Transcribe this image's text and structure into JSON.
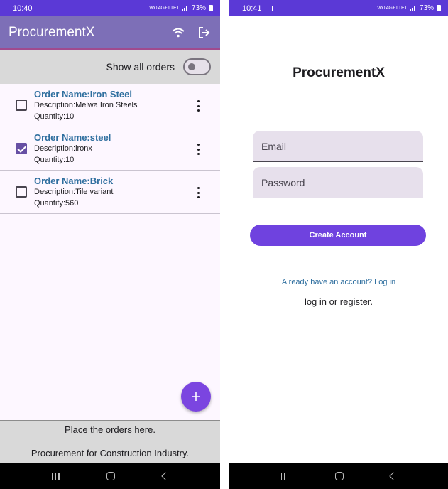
{
  "left_screen": {
    "status": {
      "time": "10:40",
      "network": "Vo0 4G+ LTE1",
      "battery": "73%"
    },
    "appbar": {
      "title": "ProcurementX",
      "wifi_icon": "wifi-icon",
      "logout_icon": "logout-icon"
    },
    "toggle": {
      "label": "Show all orders",
      "state": "off"
    },
    "orders": [
      {
        "name": "Order Name:Iron Steel",
        "description": "Description:Melwa Iron Steels",
        "quantity": "Quantity:10",
        "checked": false
      },
      {
        "name": "Order Name:steel",
        "description": "Description:ironx",
        "quantity": "Quantity:10",
        "checked": true
      },
      {
        "name": "Order Name:Brick",
        "description": "Description:Tile variant",
        "quantity": "Quantity:560",
        "checked": false
      }
    ],
    "fab_label": "+",
    "footer": {
      "line1": "Place the orders here.",
      "line2": "Procurement for Construction Industry."
    }
  },
  "right_screen": {
    "status": {
      "time": "10:41",
      "network": "Vo0 4G+ LTE1",
      "battery": "73%"
    },
    "title": "ProcurementX",
    "email_placeholder": "Email",
    "password_placeholder": "Password",
    "create_button": "Create Account",
    "login_link": "Already have an account? Log in",
    "hint": "log in or register."
  },
  "colors": {
    "primary": "#5b39d6",
    "appbar": "#7d6fb7",
    "accent": "#6f42df",
    "link": "#2f6f9f"
  }
}
